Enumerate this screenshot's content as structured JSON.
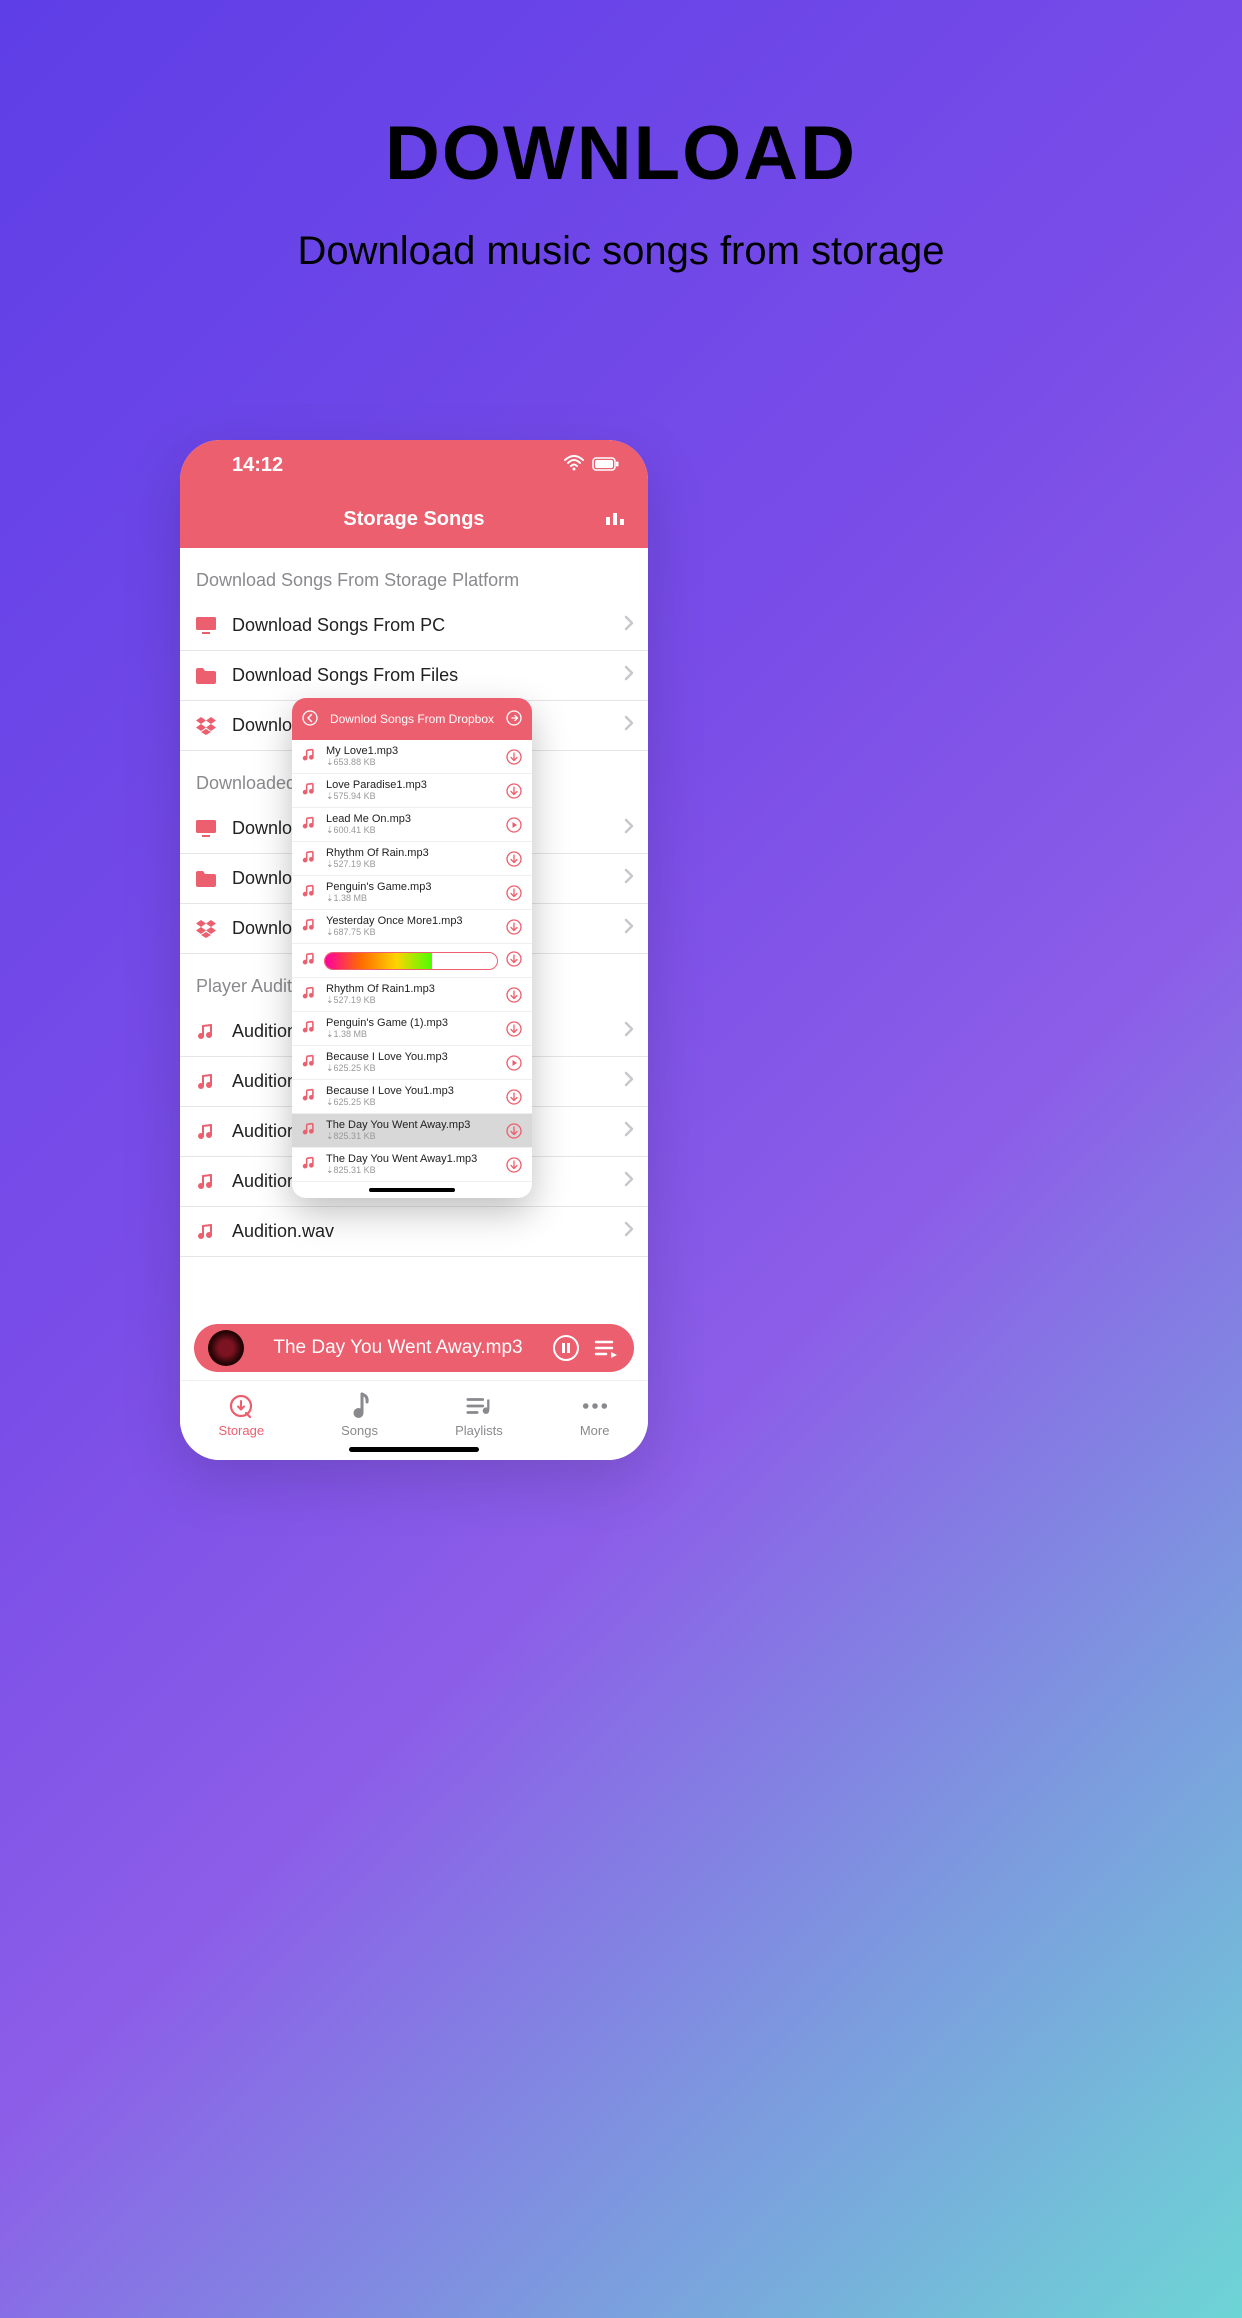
{
  "promo": {
    "title": "DOWNLOAD",
    "subtitle": "Download music songs from storage"
  },
  "status": {
    "time": "14:12"
  },
  "nav": {
    "title": "Storage Songs"
  },
  "sections": {
    "platform_header": "Download Songs From Storage Platform",
    "downloaded_header": "Downloaded S",
    "audition_header": "Player Auditic",
    "platform_rows": [
      {
        "label": "Download Songs From PC",
        "icon": "pc"
      },
      {
        "label": "Download Songs From Files",
        "icon": "folder"
      },
      {
        "label": "Download",
        "icon": "dropbox"
      }
    ],
    "downloaded_rows": [
      {
        "label": "Download",
        "icon": "pc"
      },
      {
        "label": "Download",
        "icon": "folder"
      },
      {
        "label": "Download",
        "icon": "dropbox"
      }
    ],
    "audition_rows": [
      {
        "label": "Audition.r"
      },
      {
        "label": "Audition.r"
      },
      {
        "label": "Audition.f"
      },
      {
        "label": "Audition.ape"
      },
      {
        "label": "Audition.wav"
      }
    ]
  },
  "nowplaying": {
    "title": "The Day You Went Away.mp3"
  },
  "tabs": [
    {
      "label": "Storage",
      "active": true
    },
    {
      "label": "Songs",
      "active": false
    },
    {
      "label": "Playlists",
      "active": false
    },
    {
      "label": "More",
      "active": false
    }
  ],
  "overlay": {
    "title": "Downlod Songs From Dropbox",
    "rows": [
      {
        "name": "My Love1.mp3",
        "size": "653.88 KB",
        "action": "download"
      },
      {
        "name": "Love Paradise1.mp3",
        "size": "575.94 KB",
        "action": "download"
      },
      {
        "name": "Lead Me On.mp3",
        "size": "600.41 KB",
        "action": "play"
      },
      {
        "name": "Rhythm Of Rain.mp3",
        "size": "527.19 KB",
        "action": "download"
      },
      {
        "name": "Penguin's Game.mp3",
        "size": "1.38 MB",
        "action": "download"
      },
      {
        "name": "Yesterday Once More1.mp3",
        "size": "687.75 KB",
        "action": "download"
      },
      {
        "type": "progress"
      },
      {
        "name": "Rhythm Of Rain1.mp3",
        "size": "527.19 KB",
        "action": "download"
      },
      {
        "name": "Penguin's Game (1).mp3",
        "size": "1.38 MB",
        "action": "download"
      },
      {
        "name": "Because I Love You.mp3",
        "size": "625.25 KB",
        "action": "play"
      },
      {
        "name": "Because I Love You1.mp3",
        "size": "625.25 KB",
        "action": "download"
      },
      {
        "name": "The Day You Went Away.mp3",
        "size": "825.31 KB",
        "action": "download",
        "selected": true
      },
      {
        "name": "The Day You Went Away1.mp3",
        "size": "825.31 KB",
        "action": "download"
      }
    ]
  }
}
